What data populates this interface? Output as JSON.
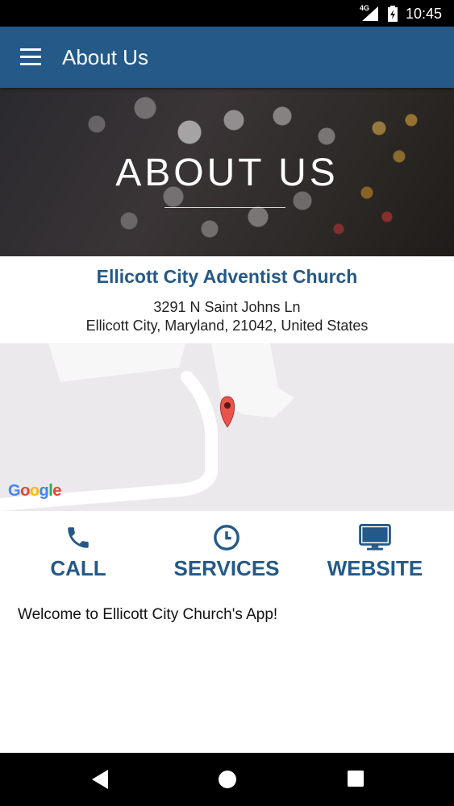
{
  "status_bar": {
    "network": "4G",
    "time": "10:45"
  },
  "app_bar": {
    "title": "About Us"
  },
  "hero": {
    "title": "ABOUT US"
  },
  "church": {
    "name": "Ellicott City Adventist Church",
    "address_line1": "3291 N Saint Johns Ln",
    "address_line2": "Ellicott City, Maryland, 21042, United States"
  },
  "map": {
    "attribution": "Google"
  },
  "actions": {
    "call": "CALL",
    "services": "SERVICES",
    "website": "WEBSITE"
  },
  "welcome_text": "Welcome to Ellicott City Church's App!",
  "colors": {
    "primary": "#245988",
    "map_bg": "#ebe9ec",
    "pin": "#e8544a"
  },
  "icons": [
    "menu-icon",
    "phone-icon",
    "clock-icon",
    "monitor-icon",
    "map-pin-icon",
    "back-icon",
    "home-icon",
    "recents-icon"
  ]
}
